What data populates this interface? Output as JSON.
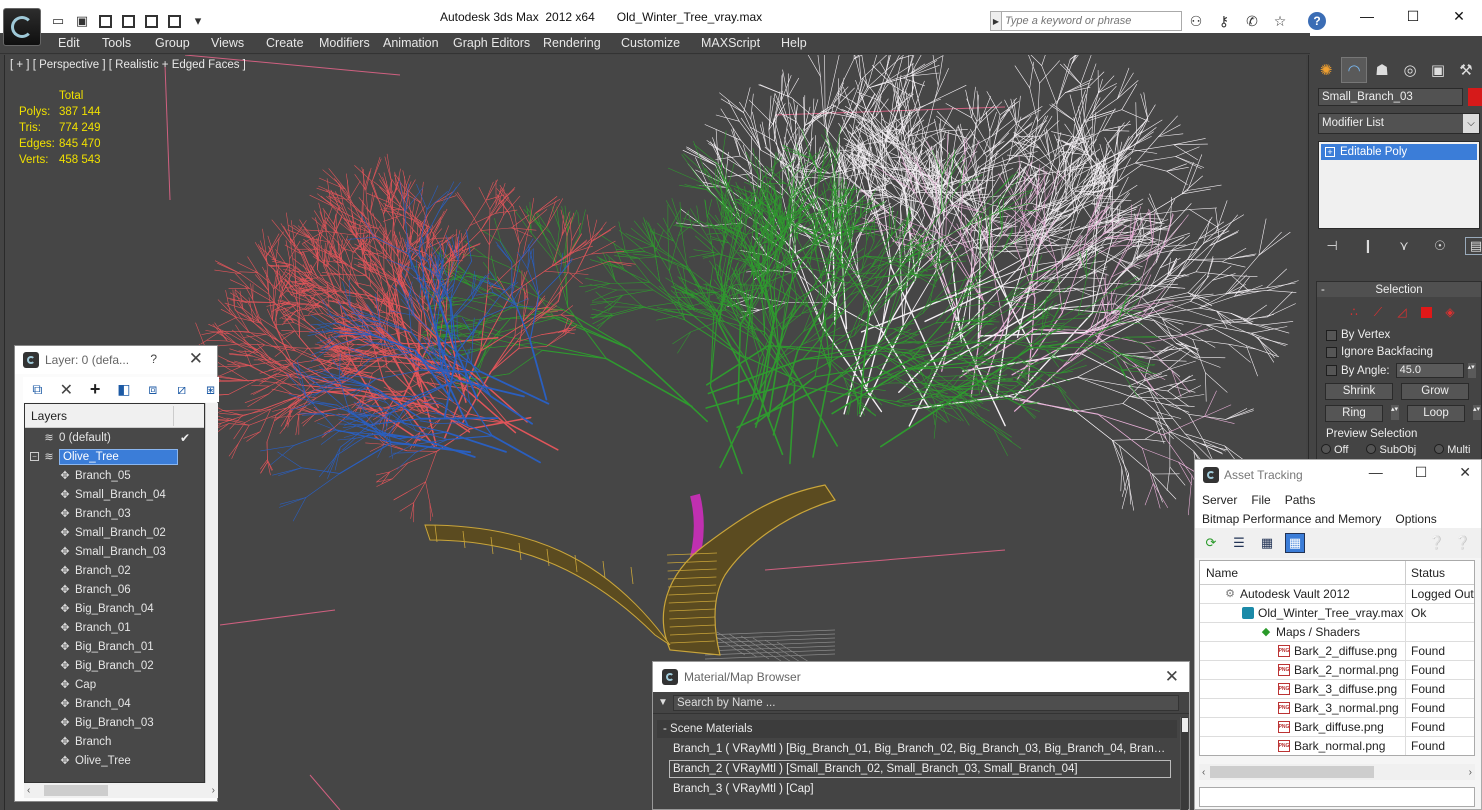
{
  "titlebar": {
    "app_title": "Autodesk 3ds Max  2012 x64",
    "file_name": "Old_Winter_Tree_vray.max",
    "search_placeholder": "Type a keyword or phrase",
    "min_glyph": "—",
    "max_glyph": "☐",
    "close_glyph": "✕"
  },
  "menu": [
    "Edit",
    "Tools",
    "Group",
    "Views",
    "Create",
    "Modifiers",
    "Animation",
    "Graph Editors",
    "Rendering",
    "Customize",
    "MAXScript",
    "Help"
  ],
  "viewport": {
    "label": "[ + ] [ Perspective ] [ Realistic + Edged Faces ]",
    "stats": {
      "header": "Total",
      "rows": [
        {
          "key": "Polys:",
          "value": "387 144"
        },
        {
          "key": "Tris:",
          "value": "774 249"
        },
        {
          "key": "Edges:",
          "value": "845 470"
        },
        {
          "key": "Verts:",
          "value": "458 543"
        }
      ]
    }
  },
  "command_panel": {
    "object_name": "Small_Branch_03",
    "object_color": "#d61a1a",
    "modifier_list_label": "Modifier List",
    "stack_item": "Editable Poly",
    "selection": {
      "title": "Selection",
      "by_vertex": "By Vertex",
      "ignore_backfacing": "Ignore Backfacing",
      "by_angle": "By Angle:",
      "angle_value": "45.0",
      "shrink": "Shrink",
      "grow": "Grow",
      "ring": "Ring",
      "loop": "Loop",
      "preview_title": "Preview Selection",
      "preview_off": "Off",
      "preview_subobj": "SubObj",
      "preview_multi": "Multi"
    }
  },
  "layer_panel": {
    "title": "Layer: 0 (defa...",
    "help": "?",
    "column_header": "Layers",
    "default_layer": "0 (default)",
    "selected_layer": "Olive_Tree",
    "children": [
      "Branch_05",
      "Small_Branch_04",
      "Branch_03",
      "Small_Branch_02",
      "Small_Branch_03",
      "Branch_02",
      "Branch_06",
      "Big_Branch_04",
      "Branch_01",
      "Big_Branch_01",
      "Big_Branch_02",
      "Cap",
      "Branch_04",
      "Big_Branch_03",
      "Branch",
      "Olive_Tree"
    ]
  },
  "material_browser": {
    "title": "Material/Map Browser",
    "search_placeholder": "Search by Name ...",
    "group_label": "- Scene Materials",
    "rows": [
      "Branch_1  ( VRayMtl )  [Big_Branch_01, Big_Branch_02, Big_Branch_03, Big_Branch_04, Branch...",
      "Branch_2  ( VRayMtl ) [Small_Branch_02, Small_Branch_03, Small_Branch_04]",
      "Branch_3  ( VRayMtl ) [Cap]"
    ]
  },
  "asset_tracking": {
    "title": "Asset Tracking",
    "menu_row1": [
      "Server",
      "File",
      "Paths"
    ],
    "menu_row2": [
      "Bitmap Performance and Memory",
      "Options"
    ],
    "col_name": "Name",
    "col_status": "Status",
    "rows": [
      {
        "name": "Autodesk Vault 2012",
        "status": "Logged Out",
        "icon": "vault",
        "indent": 1
      },
      {
        "name": "Old_Winter_Tree_vray.max",
        "status": "Ok",
        "icon": "max",
        "indent": 2
      },
      {
        "name": "Maps / Shaders",
        "status": "",
        "icon": "maps",
        "indent": 3
      },
      {
        "name": "Bark_2_diffuse.png",
        "status": "Found",
        "icon": "png",
        "indent": 4
      },
      {
        "name": "Bark_2_normal.png",
        "status": "Found",
        "icon": "png",
        "indent": 4
      },
      {
        "name": "Bark_3_diffuse.png",
        "status": "Found",
        "icon": "png",
        "indent": 4
      },
      {
        "name": "Bark_3_normal.png",
        "status": "Found",
        "icon": "png",
        "indent": 4
      },
      {
        "name": "Bark_diffuse.png",
        "status": "Found",
        "icon": "png",
        "indent": 4
      },
      {
        "name": "Bark_normal.png",
        "status": "Found",
        "icon": "png",
        "indent": 4
      }
    ]
  },
  "tree_colors": {
    "trunk": "#c9a53a",
    "red_branches": "#e0555a",
    "blue_branches": "#2a5fc0",
    "green_branches": "#2f9a2f",
    "white_branches": "#f4f0f4",
    "pink_branches": "#e8b0d8",
    "magenta": "#c030b0"
  }
}
